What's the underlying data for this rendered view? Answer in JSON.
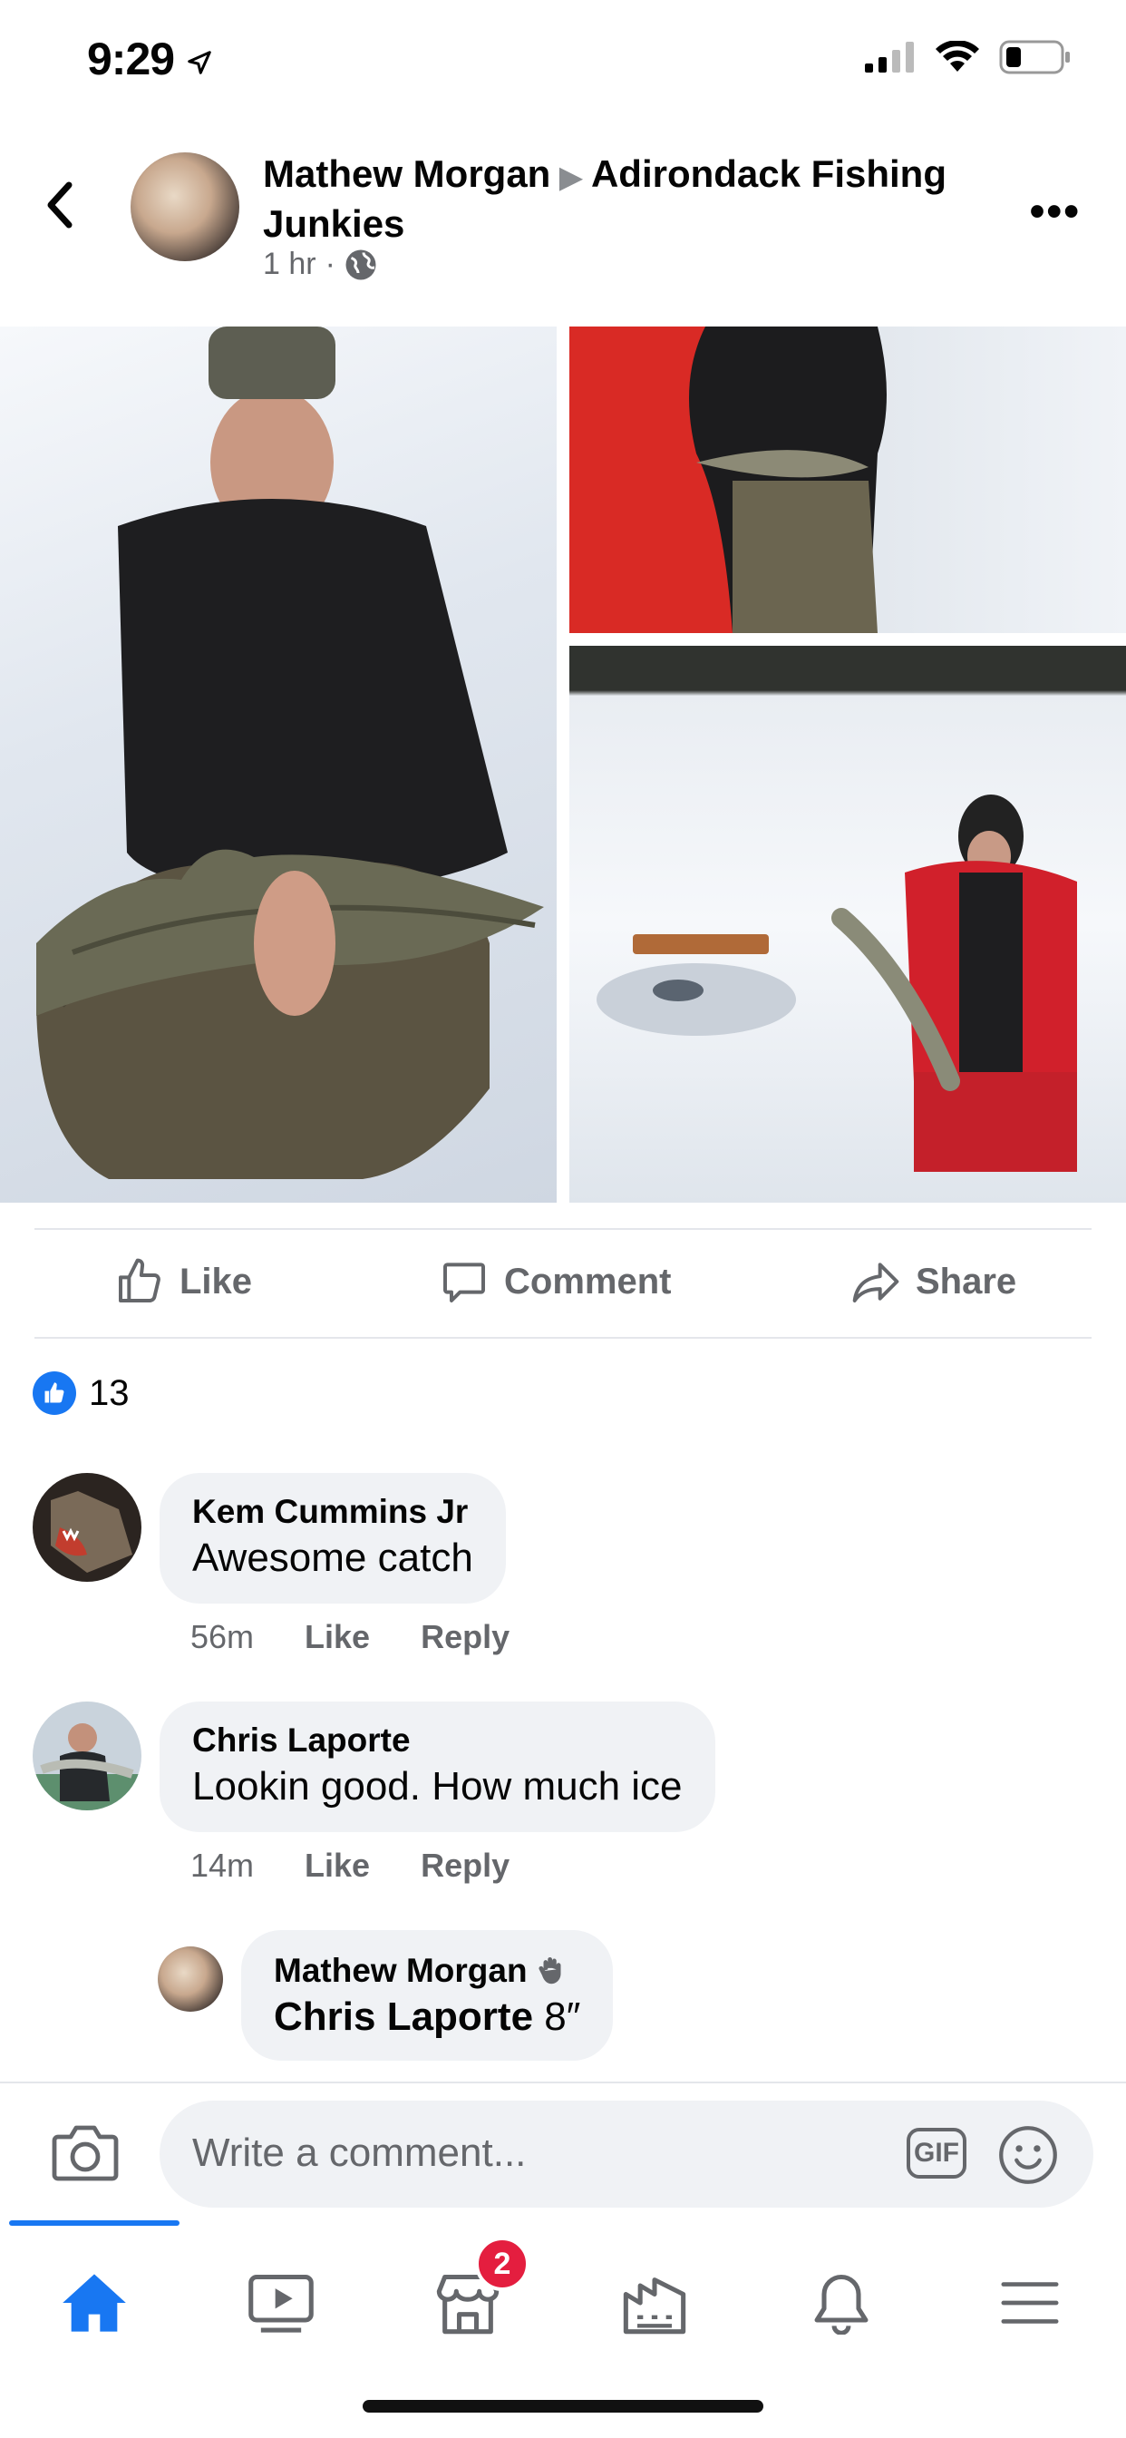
{
  "status_bar": {
    "time": "9:29"
  },
  "post": {
    "author": "Mathew Morgan",
    "group": "Adirondack Fishing Junkies",
    "timestamp": "1 hr",
    "privacy_icon": "globe-icon"
  },
  "actions": {
    "like": "Like",
    "comment": "Comment",
    "share": "Share"
  },
  "reactions": {
    "count": "13"
  },
  "comments": [
    {
      "name": "Kem Cummins Jr",
      "text": "Awesome catch",
      "time": "56m",
      "like": "Like",
      "reply": "Reply"
    },
    {
      "name": "Chris Laporte",
      "text": "Lookin good. How much ice",
      "time": "14m",
      "like": "Like",
      "reply": "Reply"
    }
  ],
  "reply": {
    "name": "Mathew Morgan",
    "mention": "Chris Laporte",
    "text": "8″"
  },
  "composer": {
    "placeholder": "Write a comment...",
    "gif_label": "GIF"
  },
  "tabbar": {
    "marketplace_badge": "2"
  },
  "colors": {
    "accent": "#1877f2",
    "badge": "#e41e3f",
    "bubble": "#f0f2f5",
    "secondary_text": "#65676b"
  }
}
